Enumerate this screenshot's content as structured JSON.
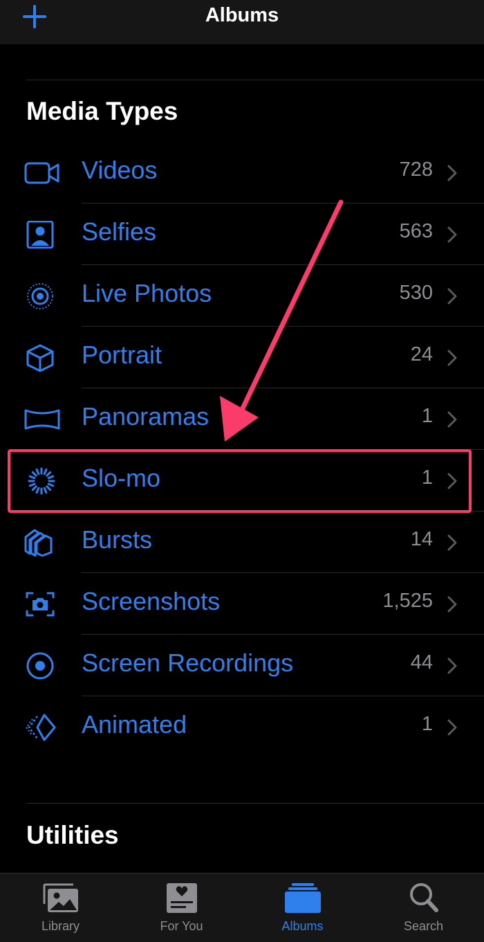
{
  "header": {
    "title": "Albums",
    "add_icon": "plus-icon"
  },
  "sections": {
    "media_types": "Media Types",
    "utilities": "Utilities"
  },
  "accent_color": "#2f80ed",
  "highlight_color": "#fa3c6a",
  "media_types": [
    {
      "label": "Videos",
      "count": "728",
      "icon": "video-camera-icon"
    },
    {
      "label": "Selfies",
      "count": "563",
      "icon": "selfie-portrait-icon"
    },
    {
      "label": "Live Photos",
      "count": "530",
      "icon": "live-photos-icon"
    },
    {
      "label": "Portrait",
      "count": "24",
      "icon": "cube-icon"
    },
    {
      "label": "Panoramas",
      "count": "1",
      "icon": "panorama-icon"
    },
    {
      "label": "Slo-mo",
      "count": "1",
      "icon": "slo-mo-icon",
      "highlighted": true
    },
    {
      "label": "Bursts",
      "count": "14",
      "icon": "bursts-icon"
    },
    {
      "label": "Screenshots",
      "count": "1,525",
      "icon": "screenshot-icon"
    },
    {
      "label": "Screen Recordings",
      "count": "44",
      "icon": "screen-recording-icon"
    },
    {
      "label": "Animated",
      "count": "1",
      "icon": "animated-icon"
    }
  ],
  "tabs": [
    {
      "label": "Library",
      "icon": "library-photos-icon",
      "active": false
    },
    {
      "label": "For You",
      "icon": "for-you-heart-icon",
      "active": false
    },
    {
      "label": "Albums",
      "icon": "albums-stack-icon",
      "active": true
    },
    {
      "label": "Search",
      "icon": "search-icon",
      "active": false
    }
  ]
}
